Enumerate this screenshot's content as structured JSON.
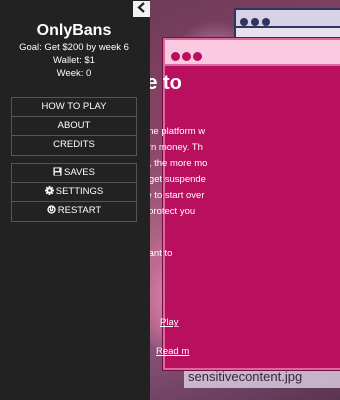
{
  "sidebar": {
    "toggle_icon": "chevron-left-icon",
    "title": "OnlyBans",
    "goal": "Goal: Get $200 by week 6",
    "wallet": "Wallet: $1",
    "week": "Week: 0",
    "menu_primary": [
      "HOW TO PLAY",
      "ABOUT",
      "CREDITS"
    ],
    "menu_secondary": [
      {
        "label": "SAVES",
        "icon": "save-icon"
      },
      {
        "label": "SETTINGS",
        "icon": "gear-icon"
      },
      {
        "label": "RESTART",
        "icon": "power-icon"
      }
    ]
  },
  "stage": {
    "file_caption": "sensitivecontent.jpg"
  },
  "modal": {
    "title": "Welcome to",
    "body_lines": [
      "OnlyBans is an online platform w",
      "attract fans and earn money. Th",
      "fans! The more fans, the more mo",
      "your account might get suspende",
      "and then you'll have to start over",
      "you also want to protect you"
    ],
    "question": "Want to",
    "link_play": "Play",
    "link_read": "Read m"
  },
  "colors": {
    "sidebar_bg": "#222222",
    "modal_bg": "#b8105e",
    "modal_bar": "#fbc9e0"
  }
}
